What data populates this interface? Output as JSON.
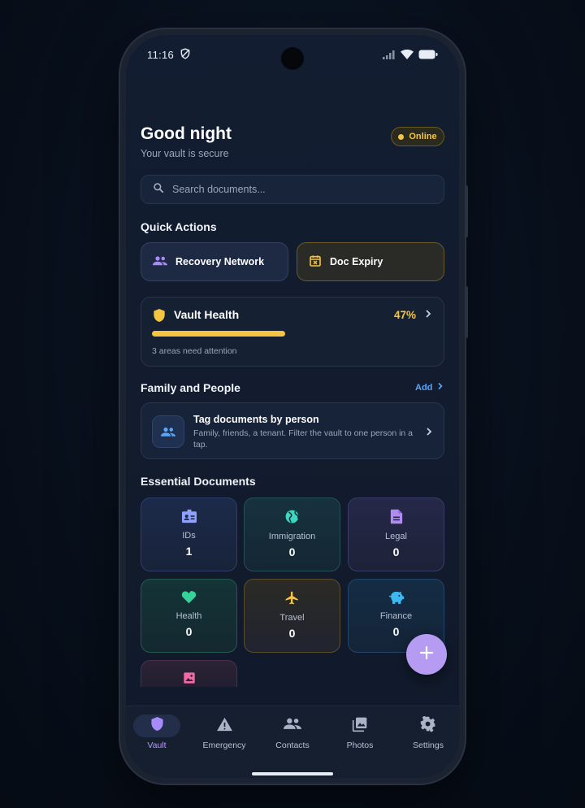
{
  "status_bar": {
    "time": "11:16"
  },
  "header": {
    "greeting": "Good night",
    "subtitle": "Your vault is secure",
    "status_badge": "Online"
  },
  "search": {
    "placeholder": "Search documents..."
  },
  "quick_actions": {
    "title": "Quick Actions",
    "items": [
      {
        "label": "Recovery Network",
        "icon": "people-icon"
      },
      {
        "label": "Doc Expiry",
        "icon": "calendar-x-icon"
      }
    ]
  },
  "vault_health": {
    "title": "Vault Health",
    "percent_text": "47%",
    "progress": 0.47,
    "note": "3 areas need attention"
  },
  "family": {
    "title": "Family and People",
    "add_label": "Add",
    "card_title": "Tag documents by person",
    "card_desc": "Family, friends, a tenant. Filter the vault to one person in a tap."
  },
  "essential": {
    "title": "Essential Documents",
    "tiles": [
      {
        "label": "IDs",
        "count": "1",
        "icon": "id-card-icon",
        "color": "#8fa0ff"
      },
      {
        "label": "Immigration",
        "count": "0",
        "icon": "globe-icon",
        "color": "#3ed6c0"
      },
      {
        "label": "Legal",
        "count": "0",
        "icon": "document-icon",
        "color": "#b08cf2"
      },
      {
        "label": "Health",
        "count": "0",
        "icon": "heart-icon",
        "color": "#35d39a"
      },
      {
        "label": "Travel",
        "count": "0",
        "icon": "airplane-icon",
        "color": "#f5c542"
      },
      {
        "label": "Finance",
        "count": "0",
        "icon": "piggy-bank-icon",
        "color": "#3db8f0"
      },
      {
        "label": "",
        "count": "",
        "icon": "image-icon",
        "color": "#f06aa8"
      }
    ]
  },
  "nav": {
    "items": [
      {
        "label": "Vault",
        "icon": "shield-icon",
        "active": true
      },
      {
        "label": "Emergency",
        "icon": "warning-icon"
      },
      {
        "label": "Contacts",
        "icon": "contacts-icon"
      },
      {
        "label": "Photos",
        "icon": "photos-icon"
      },
      {
        "label": "Settings",
        "icon": "gear-icon"
      }
    ]
  },
  "colors": {
    "accent": "#b59cf2",
    "warning": "#f5c542",
    "link": "#5da6f5",
    "background": "#121c2e"
  }
}
